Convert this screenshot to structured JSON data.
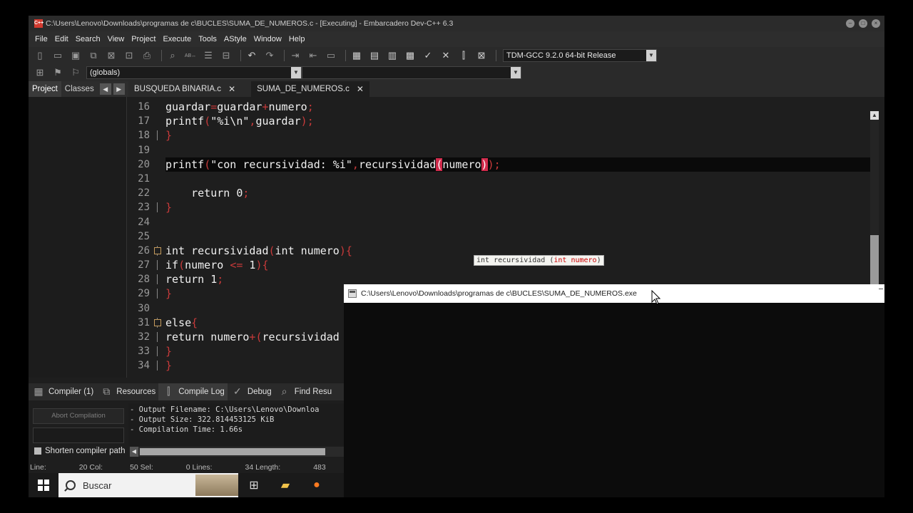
{
  "window": {
    "title": "C:\\Users\\Lenovo\\Downloads\\programas de c\\BUCLES\\SUMA_DE_NUMEROS.c - [Executing] - Embarcadero Dev-C++ 6.3",
    "app_icon_label": "C++"
  },
  "menu": [
    "File",
    "Edit",
    "Search",
    "View",
    "Project",
    "Execute",
    "Tools",
    "AStyle",
    "Window",
    "Help"
  ],
  "toolbar": {
    "compiler": "TDM-GCC 9.2.0 64-bit Release",
    "scope": "(globals)"
  },
  "left_panel": {
    "tabs": [
      "Project",
      "Classes"
    ]
  },
  "editor": {
    "tabs": [
      {
        "label": "BUSQUEDA BINARIA.c",
        "active": false
      },
      {
        "label": "SUMA_DE_NUMEROS.c",
        "active": true
      }
    ],
    "line_numbers": [
      "16",
      "17",
      "18",
      "19",
      "20",
      "21",
      "22",
      "23",
      "24",
      "25",
      "26",
      "27",
      "28",
      "29",
      "30",
      "31",
      "32",
      "33",
      "34"
    ],
    "tooltip": {
      "prefix": "int recursividad (",
      "arg": "int numero",
      "suffix": ")"
    }
  },
  "bottom_panel": {
    "tabs": [
      "Compiler (1)",
      "Resources",
      "Compile Log",
      "Debug",
      "Find Resu"
    ],
    "active_tab": "Compile Log",
    "abort_label": "Abort Compilation",
    "shorten_label": "Shorten compiler path",
    "log": [
      "- Output Filename: C:\\Users\\Lenovo\\Downloa",
      "- Output Size: 322.814453125 KiB",
      "- Compilation Time: 1.66s"
    ]
  },
  "status": {
    "line_label": "Line:",
    "line_value": "20 Col:",
    "col_value": "50 Sel:",
    "sel_value": "0 Lines:",
    "lines_value": "34 Length:",
    "length_value": "483"
  },
  "taskbar": {
    "search_placeholder": "Buscar"
  },
  "console": {
    "title": "C:\\Users\\Lenovo\\Downloads\\programas de c\\BUCLES\\SUMA_DE_NUMEROS.exe"
  },
  "colors": {
    "accent_red": "#d12b4c",
    "punctuation": "#c83a3a",
    "editor_bg": "#1e1e1e"
  }
}
